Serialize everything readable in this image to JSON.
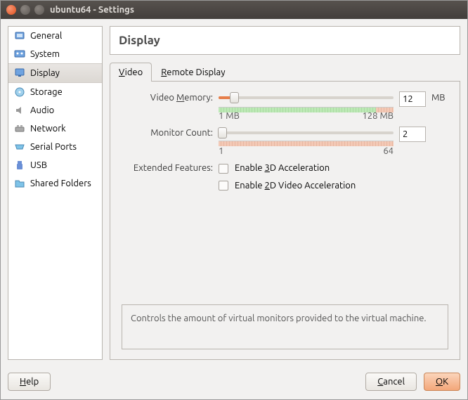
{
  "window": {
    "title": "ubuntu64 - Settings"
  },
  "sidebar": {
    "items": [
      {
        "label": "General",
        "icon": "general"
      },
      {
        "label": "System",
        "icon": "system"
      },
      {
        "label": "Display",
        "icon": "display"
      },
      {
        "label": "Storage",
        "icon": "storage"
      },
      {
        "label": "Audio",
        "icon": "audio"
      },
      {
        "label": "Network",
        "icon": "network"
      },
      {
        "label": "Serial Ports",
        "icon": "serial"
      },
      {
        "label": "USB",
        "icon": "usb"
      },
      {
        "label": "Shared Folders",
        "icon": "folder"
      }
    ],
    "selected_index": 2
  },
  "header": {
    "title": "Display"
  },
  "tabs": {
    "items": [
      {
        "label": "Video",
        "ul": "V"
      },
      {
        "label": "Remote Display",
        "ul": "R"
      }
    ],
    "active_index": 0
  },
  "video_tab": {
    "video_memory": {
      "label": "Video Memory:",
      "ul": "M",
      "value": "12",
      "unit": "MB",
      "min_label": "1 MB",
      "max_label": "128 MB",
      "fill_percent": 9
    },
    "monitor_count": {
      "label": "Monitor Count:",
      "ul": "",
      "value": "2",
      "min_label": "1",
      "max_label": "64",
      "fill_percent": 2
    },
    "extended": {
      "label": "Extended Features:",
      "opt3d": {
        "label": "Enable 3D Acceleration",
        "ul": "3",
        "checked": false
      },
      "opt2d": {
        "label": "Enable 2D Video Acceleration",
        "ul": "2",
        "checked": false
      }
    }
  },
  "help_text": "Controls the amount of virtual monitors provided to the virtual machine.",
  "footer": {
    "help": "Help",
    "help_ul": "H",
    "cancel": "Cancel",
    "cancel_ul": "C",
    "ok": "OK",
    "ok_ul": "O"
  },
  "icons": {
    "general": "#5a8dd6",
    "system": "#5a8dd6",
    "display": "#5a8dd6",
    "storage": "#5aa6d6",
    "audio": "#888",
    "network": "#888",
    "serial": "#4aa3d6",
    "usb": "#4a7bd6",
    "folder": "#4aa3d6"
  }
}
